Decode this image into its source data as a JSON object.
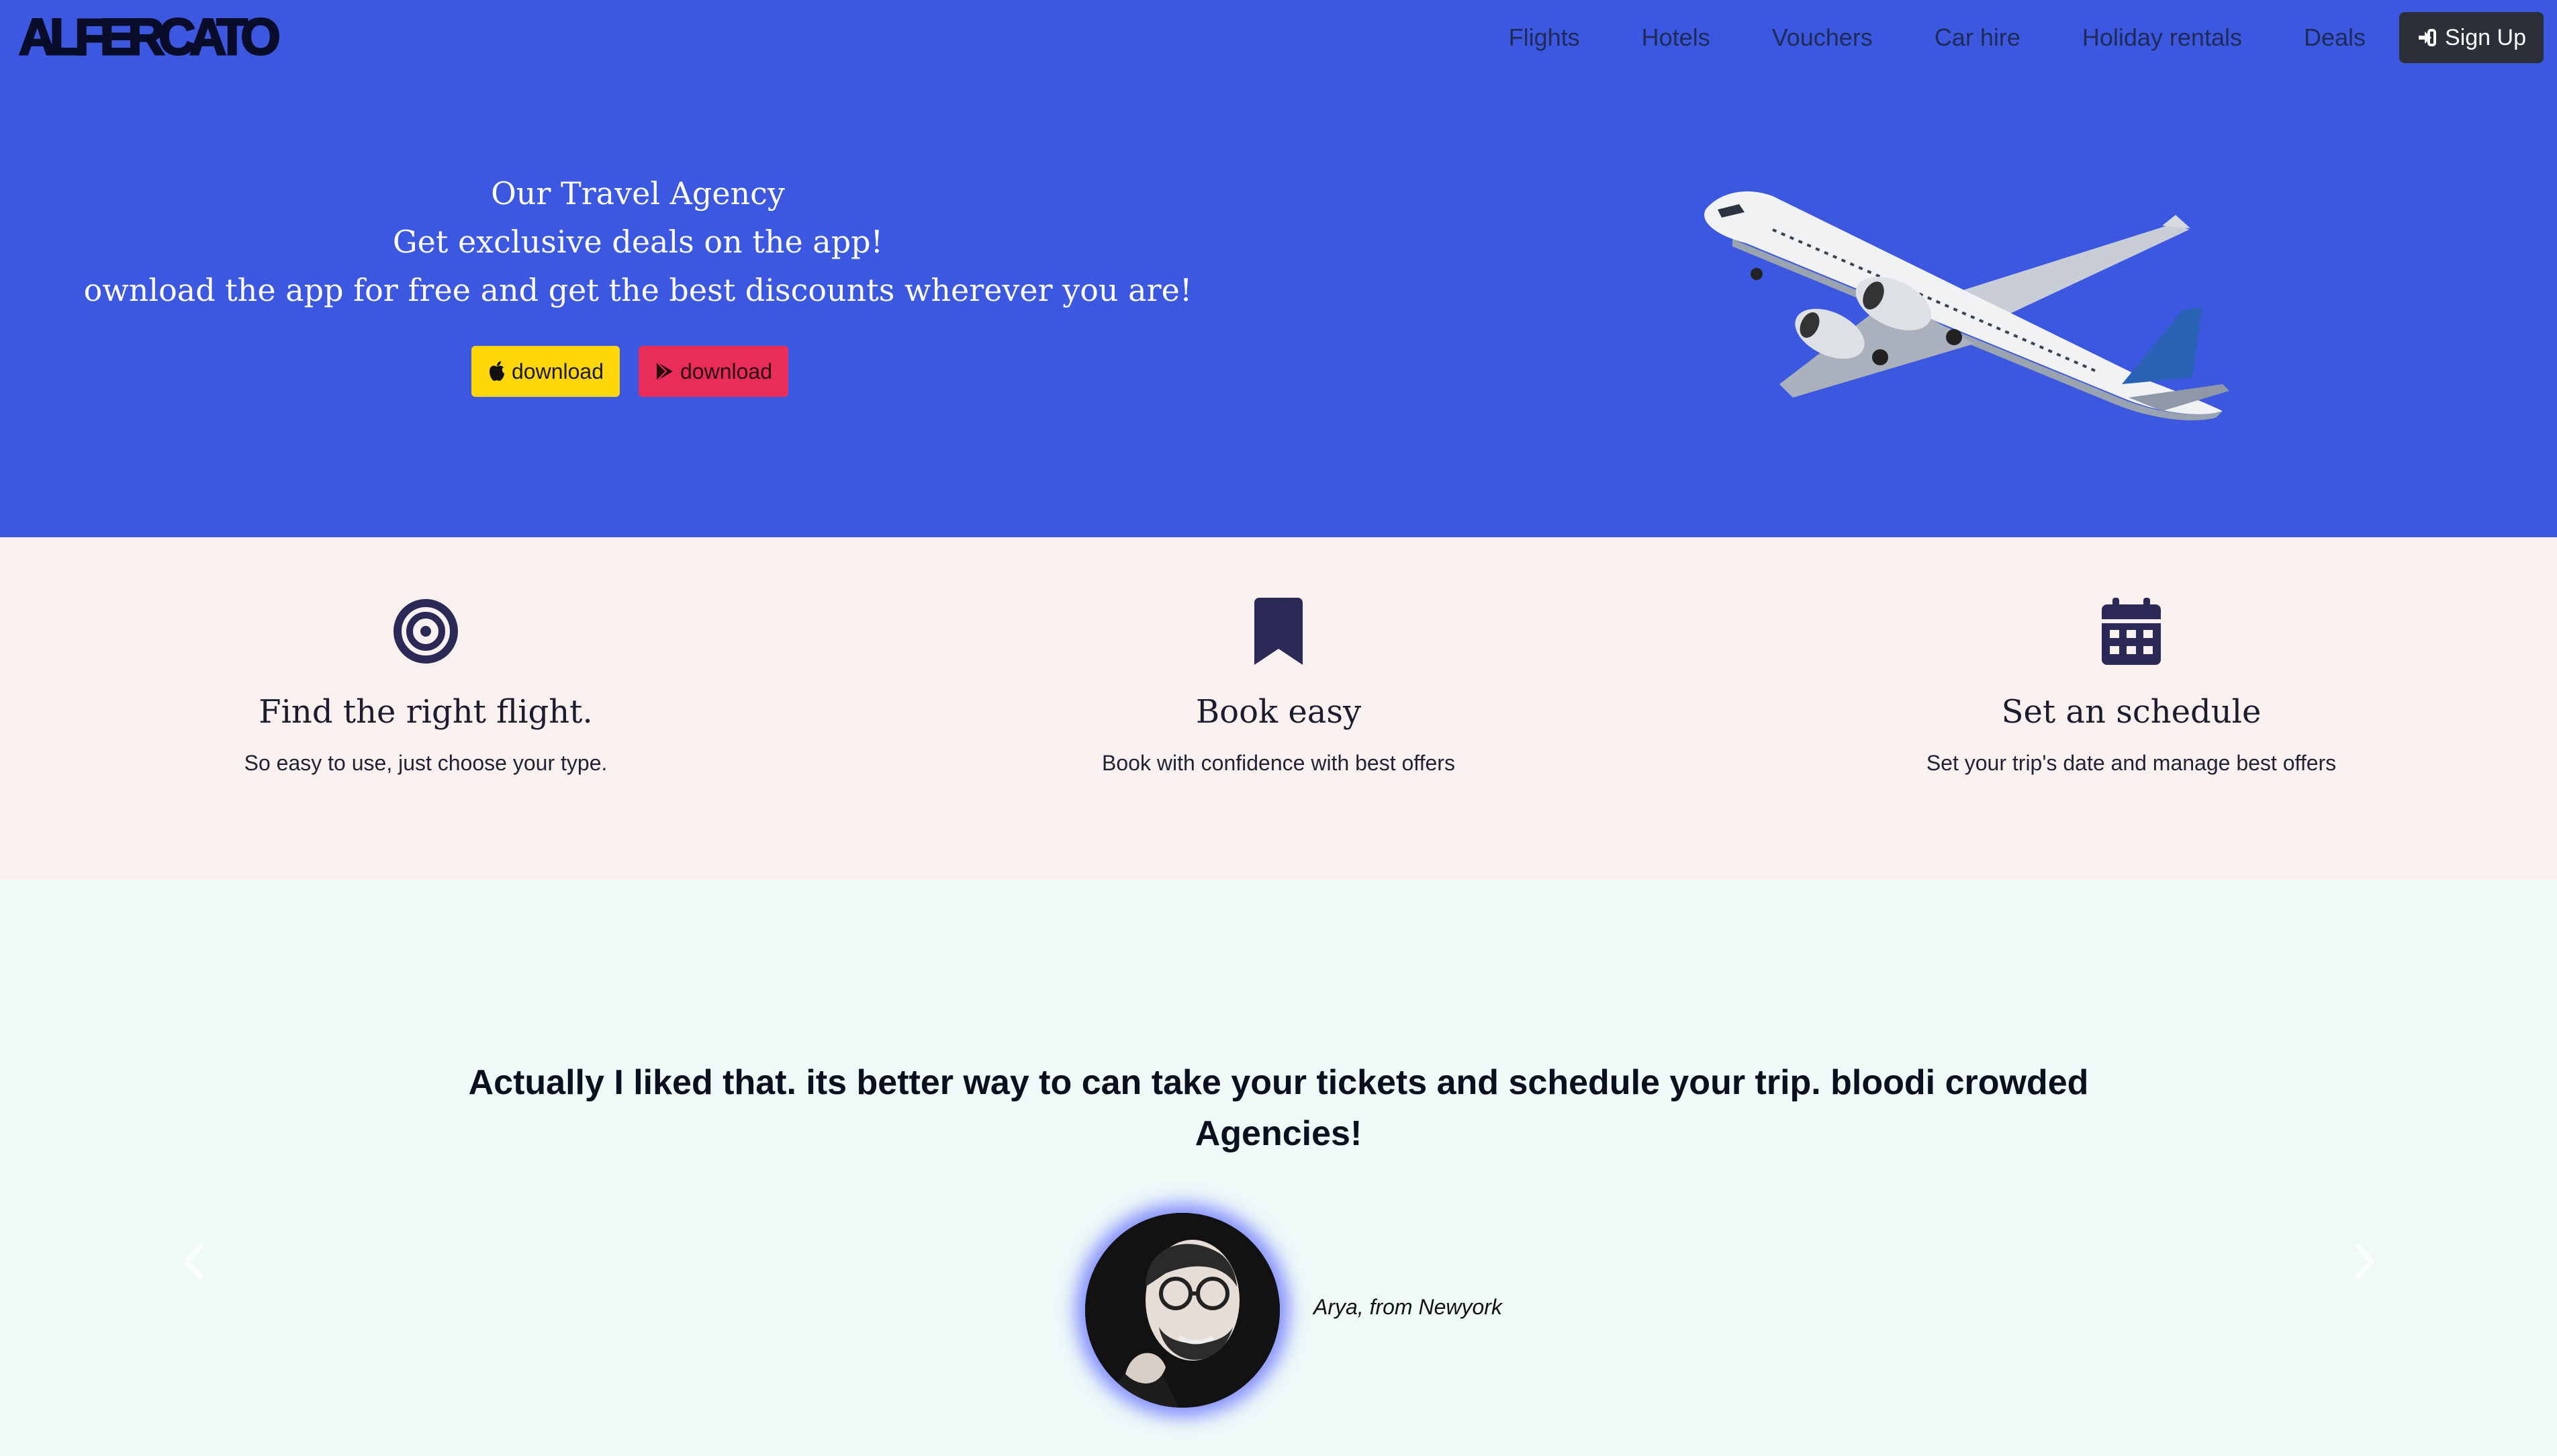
{
  "brand": {
    "logo_text": "ALFERCATO"
  },
  "nav": {
    "links": [
      "Flights",
      "Hotels",
      "Vouchers",
      "Car hire",
      "Holiday rentals",
      "Deals"
    ],
    "signup_label": "Sign Up"
  },
  "hero": {
    "line1": "Our Travel Agency",
    "line2": "Get exclusive deals on the app!",
    "line3": "ownload the app for free and get the best discounts wherever you are!",
    "apple_button": "download",
    "play_button": "download"
  },
  "features": [
    {
      "icon": "target-icon",
      "title": "Find the right flight.",
      "desc": "So easy to use, just choose your type."
    },
    {
      "icon": "bookmark-icon",
      "title": "Book easy",
      "desc": "Book with confidence with best offers"
    },
    {
      "icon": "calendar-icon",
      "title": "Set an schedule",
      "desc": "Set your trip's date and manage best offers"
    }
  ],
  "testimonial": {
    "quote": "Actually I liked that. its better way to can take your tickets and schedule your trip. bloodi crowded Agencies!",
    "author": "Arya, from Newyork"
  },
  "colors": {
    "hero_bg": "#3c57e0",
    "features_bg": "#f9f0f0",
    "testimonial_bg": "#eef9f8",
    "apple_btn": "#ffd60a",
    "play_btn": "#ea2d58",
    "icon_color": "#2b2956"
  }
}
